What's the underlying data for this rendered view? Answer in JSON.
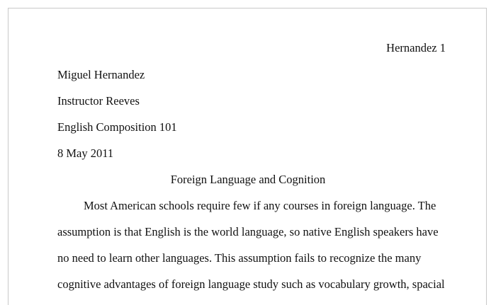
{
  "running_head": "Hernandez 1",
  "heading": {
    "name": "Miguel Hernandez",
    "instructor": "Instructor Reeves",
    "course": "English Composition 101",
    "date": "8 May 2011"
  },
  "title": "Foreign Language and Cognition",
  "body_lines": [
    "Most American schools require few if any courses in foreign language. The",
    "assumption is that English is the world language, so native English speakers have",
    "no need to learn other languages. This assumption fails to recognize the many",
    "cognitive advantages of foreign language study such as vocabulary growth, spacial"
  ]
}
